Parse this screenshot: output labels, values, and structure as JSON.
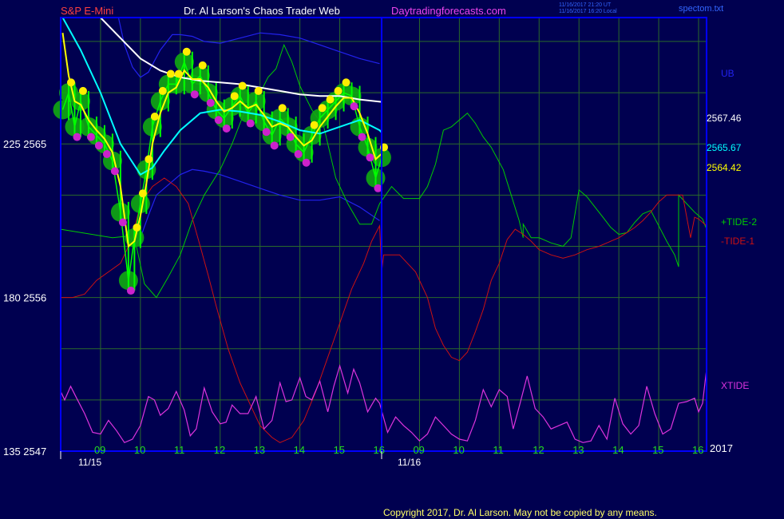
{
  "header": {
    "instrument": "S&P E-Mini",
    "site_title": "Dr. Al Larson's Chaos Trader Web",
    "site_url": "Daytradingforecasts.com",
    "timestamp_ut": "11/16/2017 21:20 UT",
    "timestamp_local": "11/16/2017 16:20 Local",
    "file_name": "spectom.txt"
  },
  "footer": {
    "copyright": "Copyright 2017, Dr. Al Larson. May not be copied by any means."
  },
  "colors": {
    "background": "#000050",
    "plot_frame": "#0000ff",
    "grid": "#2a6a2a",
    "price_bar": "#00ff00",
    "ema_fast": "#ffff00",
    "ema_mid": "#00ffff",
    "ema_slow": "#ffffff",
    "band": "#2222ee",
    "tide_plus": "#00cc00",
    "tide_minus": "#cc1111",
    "xtide": "#dd33dd",
    "dot_yellow": "#ffee00",
    "dot_magenta": "#cc22cc",
    "halo": "#11aa11",
    "title_red": "#ff4040",
    "title_white": "#ffffff",
    "title_magenta": "#ee44ee"
  },
  "chart_data": {
    "type": "line",
    "title": "S&P E-Mini",
    "y_axis_left": {
      "labels": [
        {
          "tide": "225",
          "price": "2565",
          "value": 2565
        },
        {
          "tide": "180",
          "price": "2556",
          "value": 2556
        },
        {
          "tide": "135",
          "price": "2547",
          "value": 2547
        }
      ],
      "ylim": [
        2547,
        2572.4
      ]
    },
    "x_axis": {
      "day1_label": "11/15",
      "day2_label": "11/16",
      "hour_ticks_day1": [
        "09",
        "10",
        "11",
        "12",
        "13",
        "14",
        "15",
        "16"
      ],
      "hour_ticks_day2": [
        "09",
        "10",
        "11",
        "12",
        "13",
        "14",
        "15",
        "16"
      ],
      "year_label": "2017",
      "xlim_hours": [
        8.0,
        24.2
      ]
    },
    "right_labels": [
      {
        "text": "UB",
        "key": "band"
      },
      {
        "text": "2567.46",
        "key": "ema_slow",
        "value": 2567.46
      },
      {
        "text": "2565.67",
        "key": "ema_mid",
        "value": 2565.67
      },
      {
        "text": "2564.42",
        "key": "ema_fast",
        "value": 2564.42
      },
      {
        "text": "+TIDE-2",
        "key": "tide_plus"
      },
      {
        "text": "-TIDE-1",
        "key": "tide_minus"
      },
      {
        "text": "XTIDE",
        "key": "xtide"
      }
    ],
    "series": [
      {
        "name": "price",
        "x": [
          8.05,
          8.2,
          8.35,
          8.5,
          8.7,
          8.9,
          9.1,
          9.3,
          9.5,
          9.7,
          9.85,
          10.0,
          10.15,
          10.3,
          10.5,
          10.7,
          10.9,
          11.1,
          11.3,
          11.5,
          11.7,
          11.9,
          12.1,
          12.3,
          12.5,
          12.7,
          12.9,
          13.1,
          13.3,
          13.5,
          13.7,
          13.9,
          14.1,
          14.3,
          14.5,
          14.7,
          14.9,
          15.1,
          15.3,
          15.5,
          15.7,
          15.9,
          16.05
        ],
        "y": [
          2567.0,
          2568.0,
          2566.0,
          2567.5,
          2566.0,
          2565.5,
          2565.0,
          2564.0,
          2561.0,
          2557.0,
          2559.5,
          2561.5,
          2563.5,
          2566.0,
          2567.5,
          2568.5,
          2568.5,
          2569.8,
          2568.5,
          2569.0,
          2568.0,
          2567.0,
          2566.5,
          2567.2,
          2567.8,
          2566.8,
          2567.5,
          2566.3,
          2565.5,
          2566.5,
          2566.0,
          2565.0,
          2564.5,
          2565.5,
          2566.5,
          2567.0,
          2567.5,
          2568.0,
          2567.8,
          2566.0,
          2564.8,
          2563.0,
          2564.2
        ]
      },
      {
        "name": "ema_fast",
        "x": [
          8.05,
          8.2,
          8.35,
          8.5,
          8.7,
          8.9,
          9.1,
          9.3,
          9.5,
          9.7,
          9.85,
          10.0,
          10.15,
          10.3,
          10.5,
          10.7,
          10.9,
          11.1,
          11.3,
          11.5,
          11.7,
          11.9,
          12.1,
          12.3,
          12.5,
          12.7,
          12.9,
          13.1,
          13.3,
          13.5,
          13.7,
          13.9,
          14.1,
          14.3,
          14.5,
          14.7,
          14.9,
          15.1,
          15.3,
          15.5,
          15.7,
          15.9,
          16.05
        ],
        "y": [
          2571.5,
          2569.0,
          2567.5,
          2567.3,
          2566.4,
          2565.8,
          2565.3,
          2564.5,
          2562.5,
          2559.0,
          2559.3,
          2560.8,
          2562.7,
          2565.0,
          2566.8,
          2568.0,
          2568.3,
          2569.3,
          2568.8,
          2568.8,
          2568.3,
          2567.5,
          2566.9,
          2567.1,
          2567.5,
          2567.1,
          2567.3,
          2566.7,
          2566.0,
          2566.2,
          2566.0,
          2565.4,
          2564.9,
          2565.2,
          2566.0,
          2566.6,
          2567.2,
          2567.7,
          2567.7,
          2566.8,
          2565.6,
          2564.1,
          2564.42
        ]
      },
      {
        "name": "ema_mid",
        "x": [
          8.05,
          8.5,
          9.0,
          9.5,
          10.0,
          10.3,
          10.6,
          11.0,
          11.5,
          12.0,
          12.5,
          13.0,
          13.5,
          14.0,
          14.5,
          15.0,
          15.5,
          16.0,
          16.05
        ],
        "y": [
          2572.4,
          2570.5,
          2568.0,
          2565.0,
          2563.2,
          2563.6,
          2564.6,
          2565.8,
          2566.8,
          2567.0,
          2566.9,
          2566.7,
          2566.3,
          2565.8,
          2565.6,
          2566.0,
          2566.4,
          2565.8,
          2565.67
        ]
      },
      {
        "name": "ema_slow",
        "x": [
          9.0,
          9.5,
          10.0,
          10.5,
          11.0,
          11.5,
          12.0,
          12.5,
          13.0,
          13.5,
          14.0,
          14.5,
          15.0,
          15.5,
          16.05
        ],
        "y": [
          2572.4,
          2571.2,
          2570.0,
          2569.3,
          2568.9,
          2568.7,
          2568.6,
          2568.5,
          2568.3,
          2568.1,
          2567.9,
          2567.8,
          2567.8,
          2567.6,
          2567.46
        ]
      },
      {
        "name": "upper_band",
        "x": [
          9.45,
          9.6,
          9.8,
          10.0,
          10.2,
          10.5,
          10.8,
          11.0,
          11.3,
          11.6,
          12.0,
          12.5,
          13.0,
          13.5,
          14.0,
          14.5,
          15.0,
          15.5,
          16.0
        ],
        "y": [
          2572.4,
          2570.8,
          2569.5,
          2568.9,
          2569.2,
          2570.5,
          2571.4,
          2571.4,
          2571.3,
          2571.0,
          2570.9,
          2571.2,
          2571.5,
          2571.4,
          2571.2,
          2570.8,
          2570.4,
          2570.0,
          2569.7
        ]
      },
      {
        "name": "lower_band",
        "x": [
          9.8,
          10.0,
          10.2,
          10.4,
          10.6,
          10.8,
          11.0,
          11.3,
          11.6,
          12.0,
          12.5,
          13.0,
          13.5,
          14.0,
          14.5,
          15.0,
          15.5,
          16.0
        ],
        "y": [
          2558.8,
          2559.5,
          2560.8,
          2562.0,
          2562.4,
          2562.8,
          2563.2,
          2563.5,
          2563.4,
          2563.2,
          2562.8,
          2562.4,
          2562.0,
          2561.7,
          2561.7,
          2561.9,
          2561.3,
          2560.5
        ]
      },
      {
        "name": "tide_plus",
        "x": [
          8.0,
          9.3,
          9.7,
          9.9,
          10.1,
          10.4,
          10.7,
          11.0,
          11.3,
          11.6,
          12.0,
          12.3,
          12.6,
          12.9,
          13.2,
          13.4,
          13.6,
          13.8,
          14.0,
          14.3,
          14.6,
          14.9,
          15.2,
          15.5,
          15.8,
          16.0,
          16.3,
          16.6,
          17.0,
          17.2,
          17.4,
          17.6,
          17.8,
          18.0,
          18.2,
          18.4,
          18.6,
          18.8,
          19.1,
          19.3,
          19.5,
          19.6,
          19.6,
          19.8,
          20.0,
          20.3,
          20.6,
          20.8,
          21.0,
          21.2,
          21.4,
          21.6,
          21.8,
          22.0,
          22.2,
          22.4,
          22.6,
          22.8,
          23.0,
          23.2,
          23.4,
          23.5,
          23.5,
          23.7,
          23.9,
          24.0,
          24.1,
          24.2
        ],
        "y": [
          2560.0,
          2559.5,
          2559.6,
          2559.0,
          2556.8,
          2556.0,
          2557.2,
          2558.5,
          2560.5,
          2562.0,
          2563.5,
          2565.0,
          2566.8,
          2567.5,
          2568.9,
          2569.4,
          2570.8,
          2569.8,
          2568.4,
          2567.0,
          2566.0,
          2563.0,
          2561.5,
          2560.3,
          2560.3,
          2561.5,
          2562.5,
          2561.8,
          2561.8,
          2562.5,
          2563.8,
          2565.8,
          2566.0,
          2566.4,
          2566.8,
          2566.2,
          2565.4,
          2564.8,
          2563.5,
          2562.0,
          2560.5,
          2559.5,
          2560.3,
          2559.5,
          2559.5,
          2559.2,
          2559.0,
          2559.5,
          2562.3,
          2561.9,
          2561.3,
          2560.7,
          2560.1,
          2559.7,
          2559.8,
          2560.4,
          2560.9,
          2561.1,
          2560.2,
          2559.3,
          2558.5,
          2557.8,
          2562.0,
          2561.5,
          2561.0,
          2560.8,
          2560.6,
          2560.0
        ]
      },
      {
        "name": "tide_minus",
        "x": [
          8.0,
          8.3,
          8.6,
          8.9,
          9.2,
          9.5,
          9.8,
          10.0,
          10.3,
          10.6,
          10.9,
          11.2,
          11.5,
          11.7,
          11.9,
          12.2,
          12.5,
          12.8,
          13.0,
          13.3,
          13.5,
          13.8,
          14.1,
          14.4,
          14.7,
          15.0,
          15.3,
          15.6,
          15.8,
          16.0,
          16.05,
          16.1,
          16.5,
          16.9,
          17.2,
          17.4,
          17.6,
          17.8,
          18.0,
          18.2,
          18.4,
          18.6,
          18.8,
          19.0,
          19.2,
          19.4,
          19.6,
          19.8,
          20.0,
          20.3,
          20.6,
          20.9,
          21.2,
          21.5,
          21.8,
          22.0,
          22.2,
          22.4,
          22.6,
          22.8,
          23.0,
          23.2,
          23.4,
          23.6,
          23.8,
          23.9,
          24.0,
          24.2
        ],
        "y": [
          2556.0,
          2556.0,
          2556.2,
          2557.0,
          2557.5,
          2558.0,
          2559.5,
          2561.5,
          2562.5,
          2563.0,
          2562.5,
          2561.5,
          2559.0,
          2557.3,
          2555.5,
          2553.0,
          2551.0,
          2549.5,
          2548.5,
          2547.8,
          2547.5,
          2547.8,
          2548.8,
          2550.5,
          2552.5,
          2554.5,
          2556.5,
          2558.0,
          2559.3,
          2560.2,
          2557.5,
          2558.5,
          2558.5,
          2557.5,
          2556.0,
          2554.2,
          2553.2,
          2552.5,
          2552.3,
          2552.8,
          2554.0,
          2555.3,
          2557.0,
          2558.0,
          2559.4,
          2560.0,
          2559.7,
          2559.3,
          2558.8,
          2558.5,
          2558.3,
          2558.5,
          2558.8,
          2559.0,
          2559.3,
          2559.5,
          2559.8,
          2560.1,
          2560.5,
          2561.0,
          2561.6,
          2562.0,
          2562.0,
          2562.0,
          2559.5,
          2560.7,
          2560.6,
          2560.2
        ]
      },
      {
        "name": "xtide",
        "x": [
          8.0,
          8.1,
          8.25,
          8.4,
          8.6,
          8.8,
          9.0,
          9.2,
          9.4,
          9.6,
          9.8,
          10.0,
          10.2,
          10.35,
          10.5,
          10.7,
          10.9,
          11.1,
          11.25,
          11.4,
          11.6,
          11.8,
          12.0,
          12.15,
          12.3,
          12.5,
          12.7,
          12.9,
          13.1,
          13.3,
          13.5,
          13.65,
          13.8,
          14.0,
          14.15,
          14.3,
          14.5,
          14.7,
          14.85,
          15.0,
          15.2,
          15.35,
          15.5,
          15.7,
          15.9,
          16.0,
          16.2,
          16.4,
          16.6,
          16.8,
          17.0,
          17.2,
          17.4,
          17.6,
          17.8,
          18.0,
          18.2,
          18.4,
          18.6,
          18.8,
          19.0,
          19.2,
          19.35,
          19.5,
          19.7,
          19.9,
          20.1,
          20.3,
          20.5,
          20.7,
          20.9,
          21.1,
          21.3,
          21.5,
          21.7,
          21.9,
          22.1,
          22.3,
          22.5,
          22.7,
          22.9,
          23.1,
          23.3,
          23.5,
          23.7,
          23.9,
          24.0,
          24.1,
          24.2
        ],
        "y": [
          2550.5,
          2550.0,
          2550.8,
          2550.1,
          2549.2,
          2548.1,
          2548.0,
          2548.8,
          2548.2,
          2547.5,
          2547.7,
          2548.5,
          2550.2,
          2550.0,
          2549.1,
          2549.5,
          2550.5,
          2549.4,
          2547.9,
          2548.3,
          2550.7,
          2549.3,
          2548.6,
          2548.7,
          2549.7,
          2549.2,
          2549.2,
          2550.2,
          2548.3,
          2548.8,
          2551.0,
          2549.9,
          2550.0,
          2551.3,
          2550.2,
          2550.0,
          2551.1,
          2549.3,
          2550.8,
          2552.0,
          2550.4,
          2551.8,
          2551.0,
          2549.3,
          2550.1,
          2549.8,
          2548.1,
          2549.0,
          2548.5,
          2548.1,
          2547.6,
          2548.0,
          2549.0,
          2548.5,
          2548.0,
          2547.7,
          2547.6,
          2548.8,
          2550.6,
          2549.6,
          2550.6,
          2550.2,
          2548.3,
          2549.6,
          2551.4,
          2549.5,
          2549.0,
          2548.3,
          2548.5,
          2548.7,
          2547.7,
          2547.5,
          2547.6,
          2548.5,
          2547.7,
          2550.1,
          2548.6,
          2548.0,
          2548.5,
          2550.8,
          2549.2,
          2548.0,
          2548.3,
          2549.8,
          2549.9,
          2550.1,
          2549.3,
          2549.8,
          2551.8
        ]
      }
    ],
    "legend": "right"
  }
}
